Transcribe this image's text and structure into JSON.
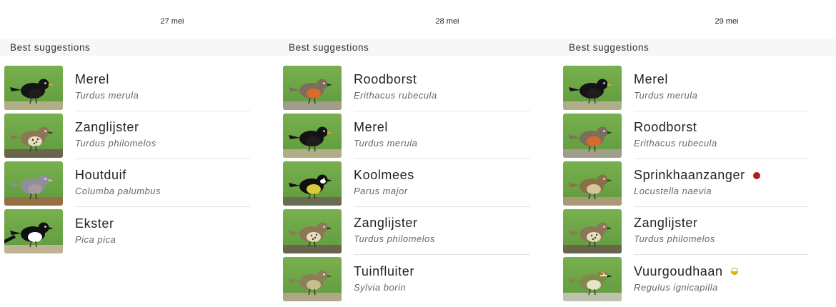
{
  "columns": [
    {
      "date": "27 mei",
      "header": "Best suggestions",
      "items": [
        {
          "name": "Merel",
          "scientific": "Turdus merula",
          "thumb": "blackbird"
        },
        {
          "name": "Zanglijster",
          "scientific": "Turdus philomelos",
          "thumb": "thrush"
        },
        {
          "name": "Houtduif",
          "scientific": "Columba palumbus",
          "thumb": "pigeon"
        },
        {
          "name": "Ekster",
          "scientific": "Pica pica",
          "thumb": "magpie"
        }
      ]
    },
    {
      "date": "28 mei",
      "header": "Best suggestions",
      "items": [
        {
          "name": "Roodborst",
          "scientific": "Erithacus rubecula",
          "thumb": "robin"
        },
        {
          "name": "Merel",
          "scientific": "Turdus merula",
          "thumb": "blackbird"
        },
        {
          "name": "Koolmees",
          "scientific": "Parus major",
          "thumb": "greattit"
        },
        {
          "name": "Zanglijster",
          "scientific": "Turdus philomelos",
          "thumb": "thrush"
        },
        {
          "name": "Tuinfluiter",
          "scientific": "Sylvia borin",
          "thumb": "warbler"
        }
      ]
    },
    {
      "date": "29 mei",
      "header": "Best suggestions",
      "items": [
        {
          "name": "Merel",
          "scientific": "Turdus merula",
          "thumb": "blackbird"
        },
        {
          "name": "Roodborst",
          "scientific": "Erithacus rubecula",
          "thumb": "robin"
        },
        {
          "name": "Sprinkhaanzanger",
          "scientific": "Locustella naevia",
          "thumb": "grasshopperwarbler",
          "badge": "red-dot",
          "badge_color": "#b61b1b"
        },
        {
          "name": "Zanglijster",
          "scientific": "Turdus philomelos",
          "thumb": "thrush"
        },
        {
          "name": "Vuurgoudhaan",
          "scientific": "Regulus ignicapilla",
          "thumb": "firecrest",
          "badge": "half-filled-dot",
          "badge_color": "#e5b500"
        }
      ]
    }
  ]
}
